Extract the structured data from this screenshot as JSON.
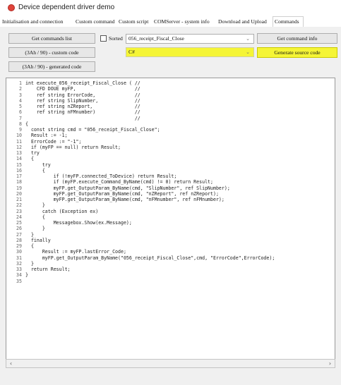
{
  "window": {
    "title": "Device dependent driver demo",
    "icon": "app-record-icon",
    "icon_color": "#e0443b"
  },
  "tabs": [
    {
      "label": "Initialisation and connection"
    },
    {
      "label": "Custom command"
    },
    {
      "label": "Custom script"
    },
    {
      "label": "COMServer - system info"
    },
    {
      "label": "Download and Upload"
    },
    {
      "label": "Commands",
      "active": true
    }
  ],
  "toolbar": {
    "get_commands_list": "Get commands list",
    "sorted_label": "Sorted",
    "sorted_checked": false,
    "command_select": "056_receipt_Fiscal_Close",
    "get_command_info": "Get command info",
    "custom_code": "(3Ah / 90) - custom code",
    "language_select": "C#",
    "generate_source_code": "Generate source code",
    "generated_code": "(3Ah / 90) - generated code",
    "highlight_color": "#f5f536"
  },
  "code_lines": [
    "int execute_056_receipt_Fiscal_Close ( //",
    "    CFD DOUE myFP,                     //",
    "    ref string ErrorCode,              //",
    "    ref string SlipNumber,             //",
    "    ref string nZReport,               //",
    "    ref string nFMnumber)              //",
    "                                       //",
    "{",
    "  const string cmd = \"056_receipt_Fiscal_Close\";",
    "  Result := -1;",
    "  ErrorCode := \"-1\";",
    "  if (myFP == null) return Result;",
    "  try",
    "  {",
    "      try",
    "      {",
    "          if (!myFP.connected_ToDevice) return Result;",
    "          if (myFP.execute_Command_ByName(cmd) != 0) return Result;",
    "          myFP.get_OutputParam_ByName(cmd, \"SlipNumber\", ref SlipNumber);",
    "          myFP.get_OutputParam_ByName(cmd, \"nZReport\", ref nZReport);",
    "          myFP.get_OutputParam_ByName(cmd, \"nFMnumber\", ref nFMnumber);",
    "      }",
    "      catch (Exception ex)",
    "      {",
    "          Messagebox.Show(ex.Message);",
    "      }",
    "  }",
    "  finally",
    "  {",
    "      Result := myFP.lastError_Code;",
    "      myFP.get_OutputParam_ByName(\"056_receipt_Fiscal_Close\",cmd, \"ErrorCode\",ErrorCode);",
    "  }",
    "  return Result;",
    "}",
    ""
  ],
  "scrollbar": {
    "left_icon": "scroll-left-arrow-icon",
    "right_icon": "scroll-right-arrow-icon"
  }
}
